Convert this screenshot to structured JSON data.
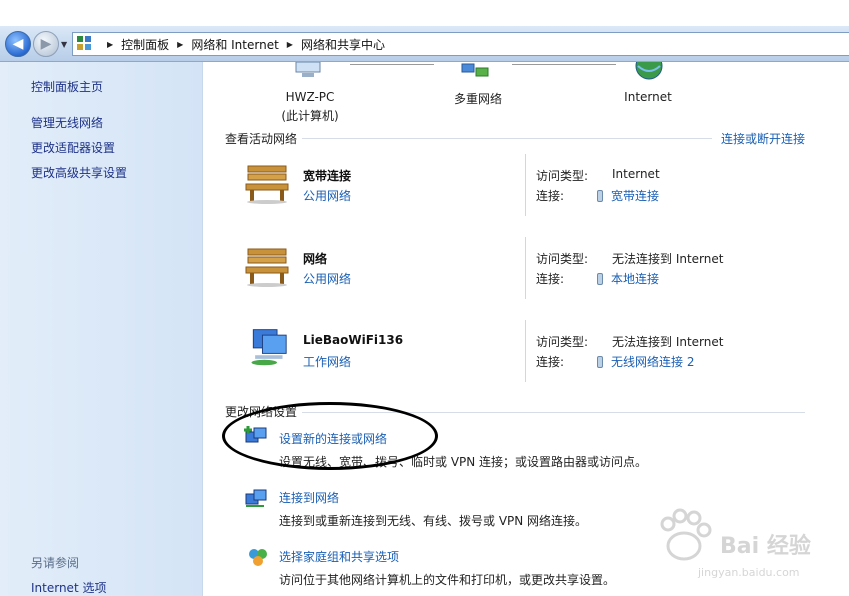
{
  "breadcrumb": {
    "items": [
      "控制面板",
      "网络和 Internet",
      "网络和共享中心"
    ]
  },
  "sidebar": {
    "home": "控制面板主页",
    "links": [
      "管理无线网络",
      "更改适配器设置",
      "更改高级共享设置"
    ],
    "see_also_title": "另请参阅",
    "see_also_links": [
      "Internet 选项"
    ]
  },
  "network_map": {
    "pc_name": "HWZ-PC",
    "pc_sub": "(此计算机)",
    "middle": "多重网络",
    "internet": "Internet"
  },
  "active": {
    "title": "查看活动网络",
    "connect_link": "连接或断开连接",
    "access_type_label": "访问类型:",
    "connection_label": "连接:",
    "networks": [
      {
        "name": "宽带连接",
        "type": "公用网络",
        "access": "Internet",
        "connection": "宽带连接",
        "icon": "bench-icon"
      },
      {
        "name": "网络",
        "type": "公用网络",
        "access": "无法连接到 Internet",
        "connection": "本地连接",
        "icon": "bench-icon"
      },
      {
        "name": "LieBaoWiFi136",
        "type": "工作网络",
        "access": "无法连接到 Internet",
        "connection": "无线网络连接 2",
        "icon": "work-network-icon"
      }
    ]
  },
  "change": {
    "title": "更改网络设置",
    "tasks": [
      {
        "link": "设置新的连接或网络",
        "desc": "设置无线、宽带、拨号、临时或 VPN 连接；或设置路由器或访问点。",
        "icon": "new-connection-icon"
      },
      {
        "link": "连接到网络",
        "desc": "连接到或重新连接到无线、有线、拨号或 VPN 网络连接。",
        "icon": "connect-network-icon"
      },
      {
        "link": "选择家庭组和共享选项",
        "desc": "访问位于其他网络计算机上的文件和打印机，或更改共享设置。",
        "icon": "homegroup-icon"
      }
    ]
  },
  "watermark": {
    "text": "Bai 经验",
    "url": "jingyan.baidu.com"
  },
  "colors": {
    "link": "#1a5fb4",
    "sidebar_bg": "#d9e7f7",
    "annotation": "#000000"
  }
}
